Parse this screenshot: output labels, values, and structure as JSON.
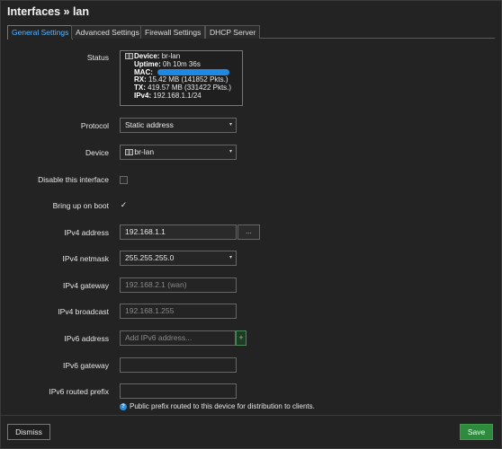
{
  "title": "Interfaces » lan",
  "tabs": [
    "General Settings",
    "Advanced Settings",
    "Firewall Settings",
    "DHCP Server"
  ],
  "status": {
    "label": "Status",
    "device_label": "Device:",
    "device": "br-lan",
    "uptime_label": "Uptime:",
    "uptime": "0h 10m 36s",
    "mac_label": "MAC:",
    "rx_label": "RX:",
    "rx": "15.42 MB (141852 Pkts.)",
    "tx_label": "TX:",
    "tx": "419.57 MB (331422 Pkts.)",
    "ipv4_label": "IPv4:",
    "ipv4": "192.168.1.1/24"
  },
  "fields": {
    "protocol": {
      "label": "Protocol",
      "value": "Static address"
    },
    "device": {
      "label": "Device",
      "value": "br-lan"
    },
    "disable": {
      "label": "Disable this interface"
    },
    "boot": {
      "label": "Bring up on boot",
      "check": "✓"
    },
    "ipv4_address": {
      "label": "IPv4 address",
      "value": "192.168.1.1",
      "button": "..."
    },
    "ipv4_netmask": {
      "label": "IPv4 netmask",
      "value": "255.255.255.0"
    },
    "ipv4_gateway": {
      "label": "IPv4 gateway",
      "placeholder": "192.168.2.1 (wan)"
    },
    "ipv4_broadcast": {
      "label": "IPv4 broadcast",
      "placeholder": "192.168.1.255"
    },
    "ipv6_address": {
      "label": "IPv6 address",
      "placeholder": "Add IPv6 address...",
      "button": "+"
    },
    "ipv6_gateway": {
      "label": "IPv6 gateway"
    },
    "ipv6_prefix": {
      "label": "IPv6 routed prefix",
      "hint": "Public prefix routed to this device for distribution to clients."
    }
  },
  "footer": {
    "dismiss": "Dismiss",
    "save": "Save"
  },
  "icons": {
    "select_caret": "▾",
    "help": "?"
  },
  "colors": {
    "accent": "#58b4ff",
    "save": "#2e8b3e",
    "background": "#232323"
  }
}
